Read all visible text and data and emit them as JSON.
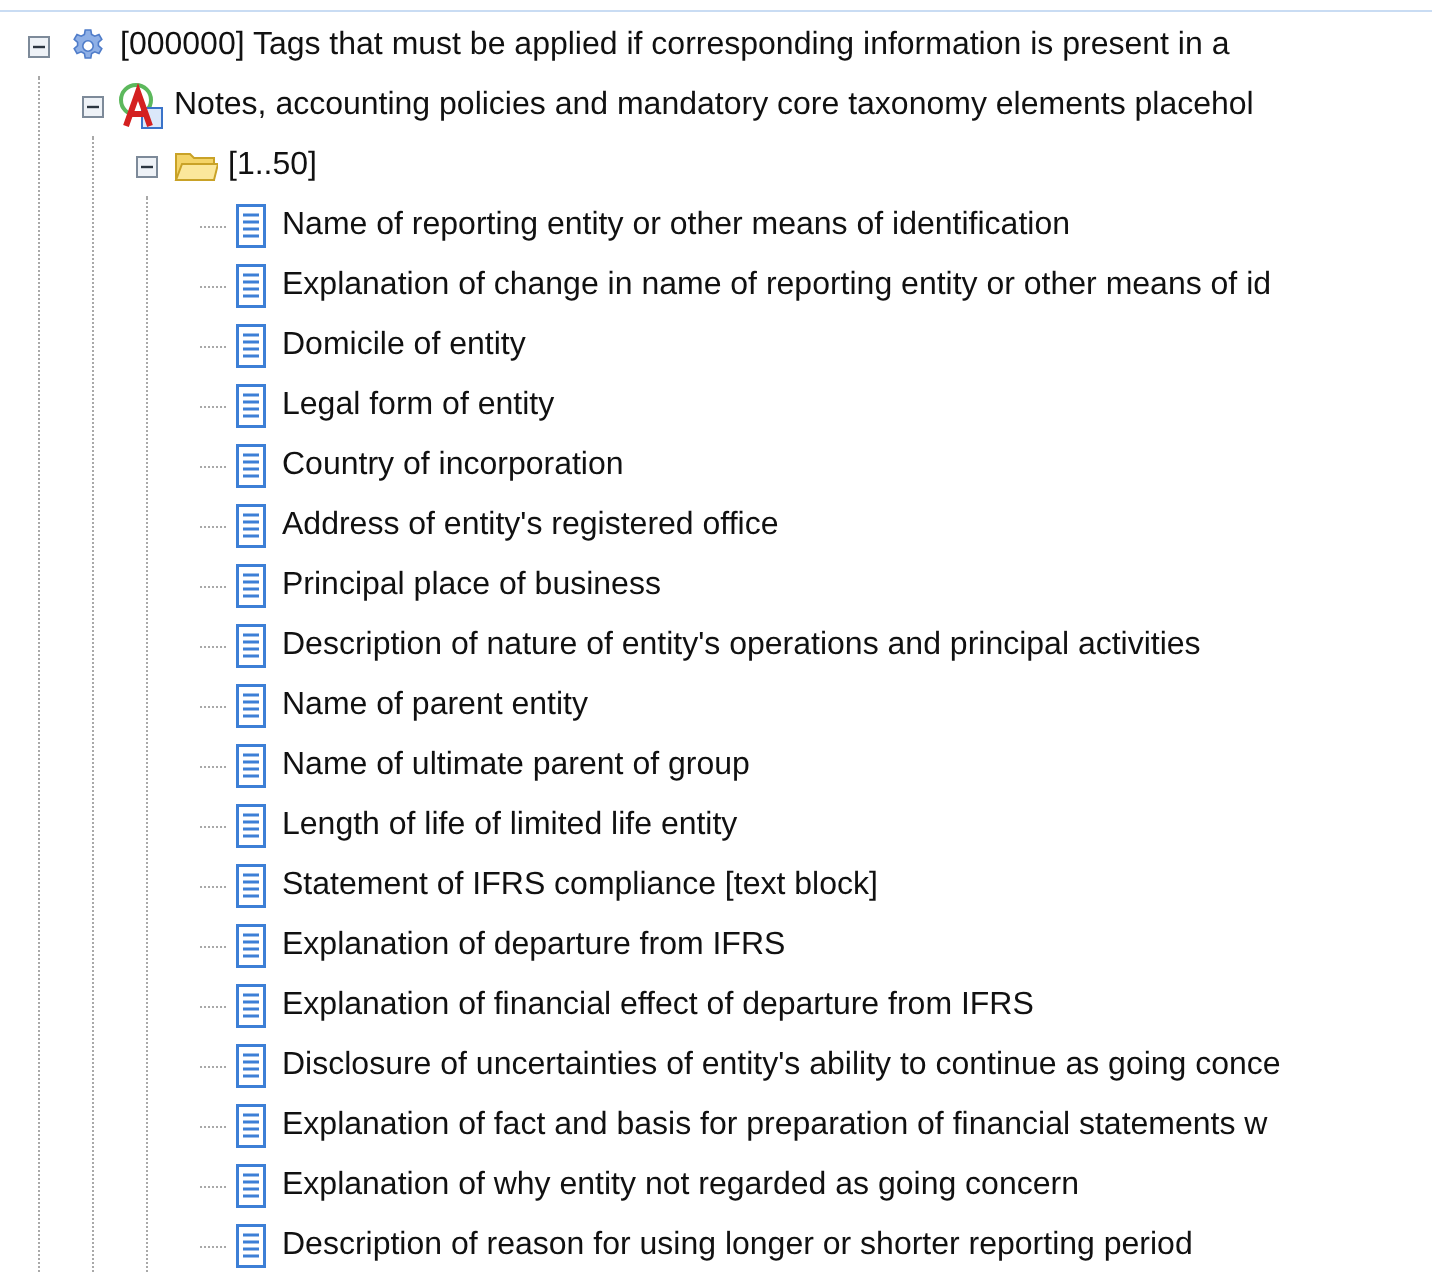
{
  "tree": [
    {
      "label": "[000000] Tags that must be applied if corresponding information is present in a",
      "kind": "gear",
      "expanded": true,
      "children": [
        {
          "label": "Notes, accounting policies and mandatory core taxonomy elements placehol",
          "kind": "abstract",
          "expanded": true,
          "children": [
            {
              "label": "[1..50]",
              "kind": "folder",
              "expanded": true,
              "children": [
                {
                  "label": "Name of reporting entity or other means of identification",
                  "kind": "item"
                },
                {
                  "label": "Explanation of change in name of reporting entity or other means of id",
                  "kind": "item"
                },
                {
                  "label": "Domicile of entity",
                  "kind": "item"
                },
                {
                  "label": "Legal form of entity",
                  "kind": "item"
                },
                {
                  "label": "Country of incorporation",
                  "kind": "item"
                },
                {
                  "label": "Address of entity's registered office",
                  "kind": "item"
                },
                {
                  "label": "Principal place of business",
                  "kind": "item"
                },
                {
                  "label": "Description of nature of entity's operations and principal activities",
                  "kind": "item"
                },
                {
                  "label": "Name of parent entity",
                  "kind": "item"
                },
                {
                  "label": "Name of ultimate parent of group",
                  "kind": "item"
                },
                {
                  "label": "Length of life of limited life entity",
                  "kind": "item"
                },
                {
                  "label": "Statement of IFRS compliance [text block]",
                  "kind": "item"
                },
                {
                  "label": "Explanation of departure from IFRS",
                  "kind": "item"
                },
                {
                  "label": "Explanation of financial effect of departure from IFRS",
                  "kind": "item"
                },
                {
                  "label": "Disclosure of uncertainties of entity's ability to continue as going conce",
                  "kind": "item"
                },
                {
                  "label": "Explanation of fact and basis for preparation of financial statements w",
                  "kind": "item"
                },
                {
                  "label": "Explanation of why entity not regarded as going concern",
                  "kind": "item"
                },
                {
                  "label": "Description of reason for using longer or shorter reporting period",
                  "kind": "item"
                }
              ]
            }
          ]
        }
      ]
    }
  ]
}
